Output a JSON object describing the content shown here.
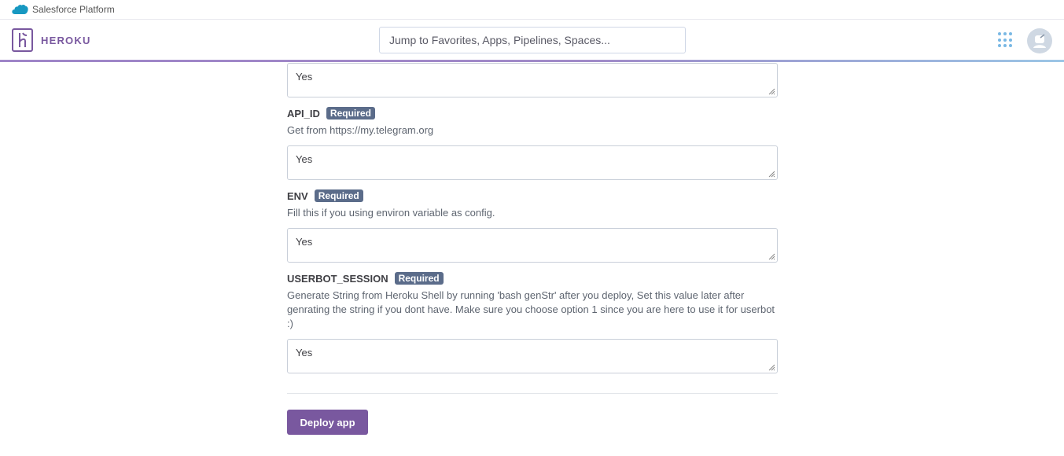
{
  "salesforce_bar": {
    "label": "Salesforce Platform"
  },
  "header": {
    "brand": "HEROKU",
    "search_placeholder": "Jump to Favorites, Apps, Pipelines, Spaces..."
  },
  "form": {
    "fields": [
      {
        "name": "",
        "required": "",
        "description": "",
        "value": "Yes"
      },
      {
        "name": "API_ID",
        "required": "Required",
        "description": "Get from https://my.telegram.org",
        "value": "Yes"
      },
      {
        "name": "ENV",
        "required": "Required",
        "description": "Fill this if you using environ variable as config.",
        "value": "Yes"
      },
      {
        "name": "USERBOT_SESSION",
        "required": "Required",
        "description": "Generate String from Heroku Shell by running 'bash genStr' after you deploy, Set this value later after genrating the string if you dont have. Make sure you choose option 1 since you are here to use it for userbot :)",
        "value": "Yes"
      }
    ],
    "deploy_label": "Deploy app"
  },
  "colors": {
    "accent": "#79589f",
    "badge": "#5b6c8a",
    "apps_icon": "#79b8e4"
  }
}
